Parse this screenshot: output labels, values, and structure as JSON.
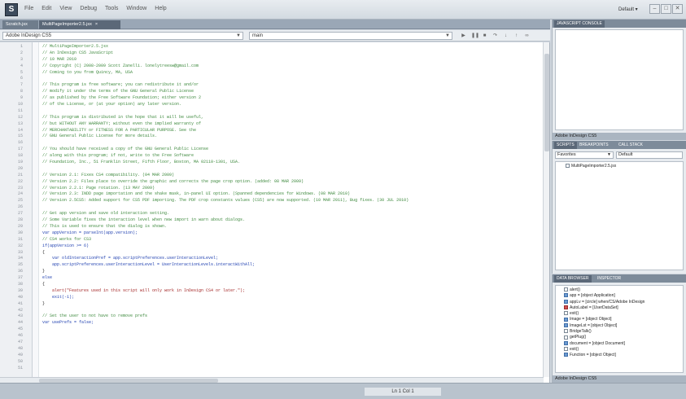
{
  "app": {
    "icon_letter": "S"
  },
  "menu": [
    "File",
    "Edit",
    "View",
    "Debug",
    "Tools",
    "Window",
    "Help"
  ],
  "workspace": {
    "label": "Default ▾"
  },
  "window_buttons": [
    "–",
    "□",
    "✕"
  ],
  "doc_tabs": [
    {
      "label": "Scratch.jsx"
    },
    {
      "label": "MultiPageImporter2.5.jsx"
    }
  ],
  "toolbar": {
    "target": "Adobe InDesign CS5",
    "engine": "main",
    "function_dd": ""
  },
  "editor": {
    "lines": [
      {
        "n": "1",
        "code": "// MultiPageImporter2.5.jsx",
        "cls": "c"
      },
      {
        "n": "2",
        "code": "// An InDesign CS5 JavaScript",
        "cls": "c"
      },
      {
        "n": "3",
        "code": "// 10 MAR 2010",
        "cls": "c"
      },
      {
        "n": "4",
        "code": "// Copyright (C) 2008-2009 Scott Zanelli. lonelytreesw@gmail.com",
        "cls": "c"
      },
      {
        "n": "5",
        "code": "// Coming to you from Quincy, MA, USA",
        "cls": "c"
      },
      {
        "n": "6",
        "code": "",
        "cls": ""
      },
      {
        "n": "7",
        "code": "// This program is free software; you can redistribute it and/or",
        "cls": "c"
      },
      {
        "n": "8",
        "code": "// modify it under the terms of the GNU General Public License",
        "cls": "c"
      },
      {
        "n": "9",
        "code": "// as published by the Free Software Foundation; either version 2",
        "cls": "c"
      },
      {
        "n": "10",
        "code": "// of the License, or (at your option) any later version.",
        "cls": "c"
      },
      {
        "n": "11",
        "code": "",
        "cls": ""
      },
      {
        "n": "12",
        "code": "// This program is distributed in the hope that it will be useful,",
        "cls": "c"
      },
      {
        "n": "13",
        "code": "// but WITHOUT ANY WARRANTY; without even the implied warranty of",
        "cls": "c"
      },
      {
        "n": "14",
        "code": "// MERCHANTABILITY or FITNESS FOR A PARTICULAR PURPOSE. See the",
        "cls": "c"
      },
      {
        "n": "15",
        "code": "// GNU General Public License for more details.",
        "cls": "c"
      },
      {
        "n": "16",
        "code": "",
        "cls": ""
      },
      {
        "n": "17",
        "code": "// You should have received a copy of the GNU General Public License",
        "cls": "c"
      },
      {
        "n": "18",
        "code": "// along with this program; if not, write to the Free Software",
        "cls": "c"
      },
      {
        "n": "19",
        "code": "// Foundation, Inc., 51 Franklin Street, Fifth Floor, Boston, MA 02110-1301, USA.",
        "cls": "c"
      },
      {
        "n": "20",
        "code": "",
        "cls": ""
      },
      {
        "n": "21",
        "code": "// Version 2.1: Fixes CS4 compatibility. (04 MAR 2009)",
        "cls": "c"
      },
      {
        "n": "22",
        "code": "// Version 2.2: Files place to override the graphic and corrects the page crop option. (added: 08 MAR 2009)",
        "cls": "c"
      },
      {
        "n": "23",
        "code": "// Version 2.2.1: Page rotation. (13 MAY 2009)",
        "cls": "c"
      },
      {
        "n": "24",
        "code": "// Version 2.3: INDD page importation and the shake mask, in-panel UI option. (Spanned dependencies for Windows. (08 MAR 2010)",
        "cls": "c"
      },
      {
        "n": "25",
        "code": "// Version 2.5CS5: Added support for CS5 PDF importing. The PDF crop constants values (CS5) are now supported. (10 MAR 2011), Bug fixes. (30 JUL 2010)",
        "cls": "c"
      },
      {
        "n": "26",
        "code": "",
        "cls": ""
      },
      {
        "n": "27",
        "code": "// Get app version and save old interaction setting.",
        "cls": "c"
      },
      {
        "n": "28",
        "code": "// Some Variable fixes the interaction level when new import in warn about dialogs.",
        "cls": "c"
      },
      {
        "n": "29",
        "code": "// This is used to ensure that the dialog is shown.",
        "cls": "c"
      },
      {
        "n": "30",
        "code": "var appVersion = parseInt(app.version);",
        "cls": "k"
      },
      {
        "n": "31",
        "code": "// CS4 works for CS3",
        "cls": "c"
      },
      {
        "n": "32",
        "code": "if(appVersion >= 6)",
        "cls": "k"
      },
      {
        "n": "33",
        "code": "{",
        "cls": ""
      },
      {
        "n": "34",
        "code": "    var oldInteractionPref = app.scriptPreferences.userInteractionLevel;",
        "cls": "k"
      },
      {
        "n": "35",
        "code": "    app.scriptPreferences.userInteractionLevel = UserInteractionLevels.interactWithAll;",
        "cls": "k"
      },
      {
        "n": "36",
        "code": "}",
        "cls": ""
      },
      {
        "n": "37",
        "code": "else",
        "cls": "k"
      },
      {
        "n": "38",
        "code": "{",
        "cls": ""
      },
      {
        "n": "39",
        "code": "    alert(\"Features used in this script will only work in InDesign CS4 or later.\");",
        "cls": "s"
      },
      {
        "n": "40",
        "code": "    exit(-1);",
        "cls": "k"
      },
      {
        "n": "41",
        "code": "}",
        "cls": ""
      },
      {
        "n": "42",
        "code": "",
        "cls": ""
      },
      {
        "n": "43",
        "code": "// Set the user to not have to remove prefs",
        "cls": "c"
      },
      {
        "n": "44",
        "code": "var usePrefs = false;",
        "cls": "k"
      },
      {
        "n": "45",
        "code": "",
        "cls": ""
      },
      {
        "n": "46",
        "code": "",
        "cls": ""
      },
      {
        "n": "47",
        "code": "",
        "cls": ""
      },
      {
        "n": "48",
        "code": "",
        "cls": ""
      },
      {
        "n": "49",
        "code": "",
        "cls": ""
      },
      {
        "n": "50",
        "code": "",
        "cls": ""
      },
      {
        "n": "51",
        "code": "",
        "cls": ""
      }
    ]
  },
  "panels": {
    "javascript_console": {
      "tab": "JAVASCRIPT CONSOLE",
      "footer": "Adobe InDesign CS5"
    },
    "scripts": {
      "tabs": [
        "SCRIPTS",
        "BREAKPOINTS",
        "CALL STACK"
      ],
      "location": "Favorites",
      "filter": "Default",
      "items": [
        "MultiPageImporter2.5.jsx"
      ]
    },
    "data_browser": {
      "tabs": [
        "DATA BROWSER",
        "INSPECTOR"
      ],
      "items": [
        {
          "label": "alert()",
          "ic": "doc"
        },
        {
          "label": "app = [object Application]",
          "ic": ""
        },
        {
          "label": "appLv = [circle] when/CS/Adobe InDesign",
          "ic": ""
        },
        {
          "label": "AutoLabel = [UserDataSet]",
          "ic": "red"
        },
        {
          "label": "exit()",
          "ic": "doc"
        },
        {
          "label": "Image = [object Object]",
          "ic": ""
        },
        {
          "label": "ImageLst = [object Object]",
          "ic": ""
        },
        {
          "label": "BridgeTalk()",
          "ic": "doc"
        },
        {
          "label": "getPlug()",
          "ic": "doc"
        },
        {
          "label": "document = [object Document]",
          "ic": ""
        },
        {
          "label": "exit()",
          "ic": "doc"
        },
        {
          "label": "Function = [object Object]",
          "ic": ""
        }
      ],
      "footer": "Adobe InDesign CS5"
    }
  },
  "status": {
    "label": "Ln 1   Col 1"
  }
}
